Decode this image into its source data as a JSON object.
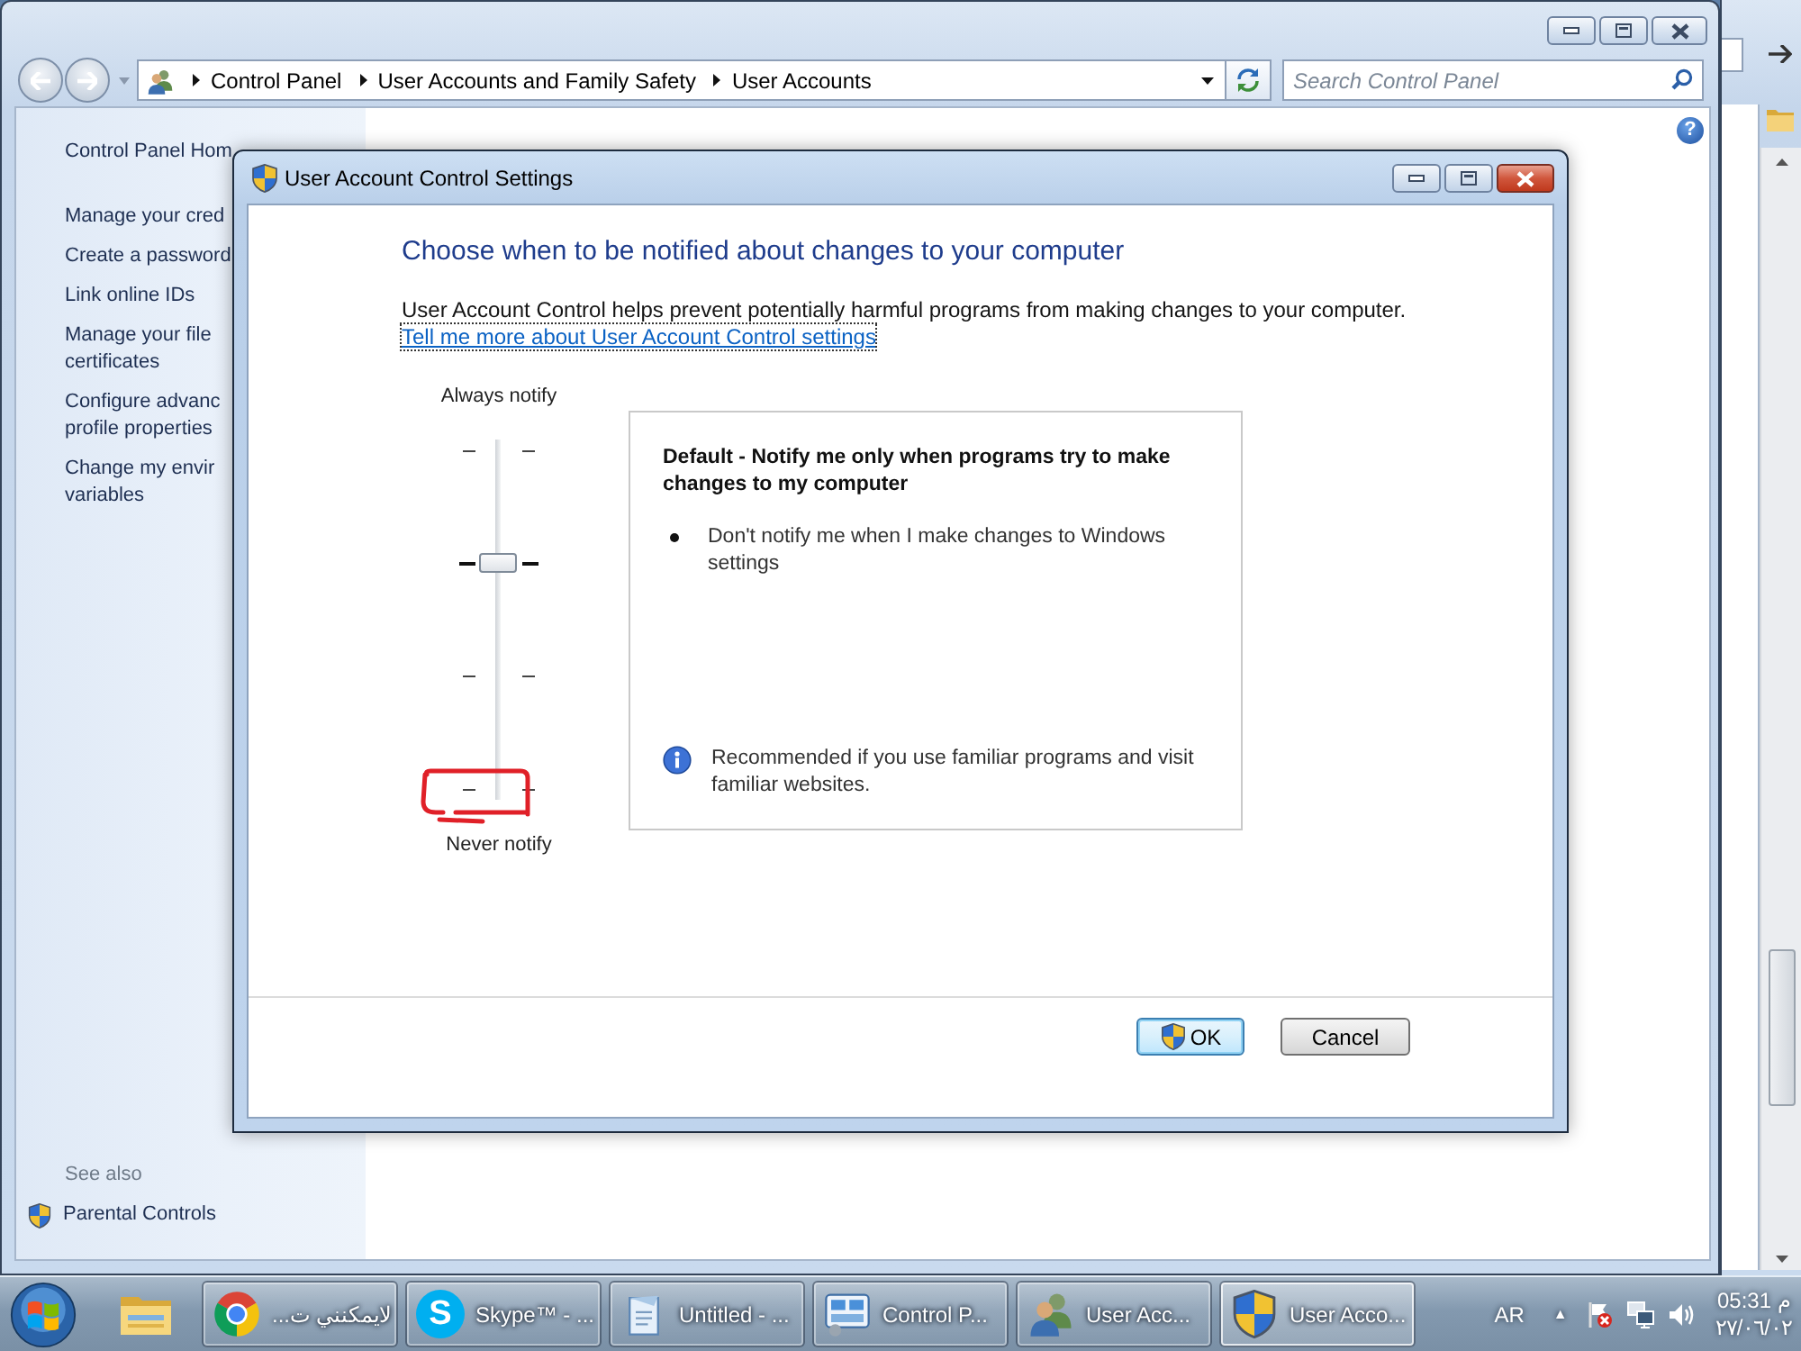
{
  "control_panel": {
    "breadcrumb": [
      "Control Panel",
      "User Accounts and Family Safety",
      "User Accounts"
    ],
    "search": {
      "placeholder": "Search Control Panel"
    },
    "help": "?",
    "sidebar": {
      "home": "Control Panel Hom",
      "tasks": [
        {
          "lines": [
            "Manage your cred"
          ]
        },
        {
          "lines": [
            "Create a password"
          ]
        },
        {
          "lines": [
            "Link online IDs"
          ]
        },
        {
          "lines": [
            "Manage your file",
            "certificates"
          ]
        },
        {
          "lines": [
            "Configure advanc",
            "profile properties"
          ]
        },
        {
          "lines": [
            "Change my envir",
            "variables"
          ]
        }
      ],
      "see_also": "See also",
      "related": [
        {
          "label": "Parental Controls"
        }
      ]
    }
  },
  "dialog": {
    "title": "User Account Control Settings",
    "heading": "Choose when to be notified about changes to your computer",
    "description": "User Account Control helps prevent potentially harmful programs from making changes to your computer.",
    "link": "Tell me more about User Account Control settings",
    "slider": {
      "top_label": "Always notify",
      "bottom_label": "Never notify",
      "level": 0.667
    },
    "detail": {
      "title": "Default - Notify me only when programs try to make changes to my computer",
      "bullets": [
        "Don't notify me when I make changes to Windows settings"
      ],
      "note": "Recommended if you use familiar programs and visit familiar websites."
    },
    "buttons": [
      {
        "label": "OK",
        "kind": "elevated",
        "default": true
      },
      {
        "label": "Cancel",
        "kind": "plain",
        "default": false
      }
    ]
  },
  "taskbar": {
    "items": [
      {
        "kind": "folder",
        "selected": false
      },
      {
        "kind": "browser",
        "label": "لايمكنني ت...",
        "selected": false
      },
      {
        "kind": "chat",
        "label": "Skype™ - ...",
        "icon_letter": "S",
        "selected": false
      },
      {
        "kind": "notepad",
        "label": "Untitled - ...",
        "selected": false
      },
      {
        "kind": "panel",
        "label": "Control P...",
        "selected": false
      },
      {
        "kind": "users",
        "label": "User Acc...",
        "selected": false
      },
      {
        "kind": "shield",
        "label": "User Acco...",
        "selected": true
      }
    ],
    "language": "AR",
    "tray_toggle": "▲",
    "time": "05:31 م",
    "date": "٢٧/٠٦/٠٢"
  }
}
